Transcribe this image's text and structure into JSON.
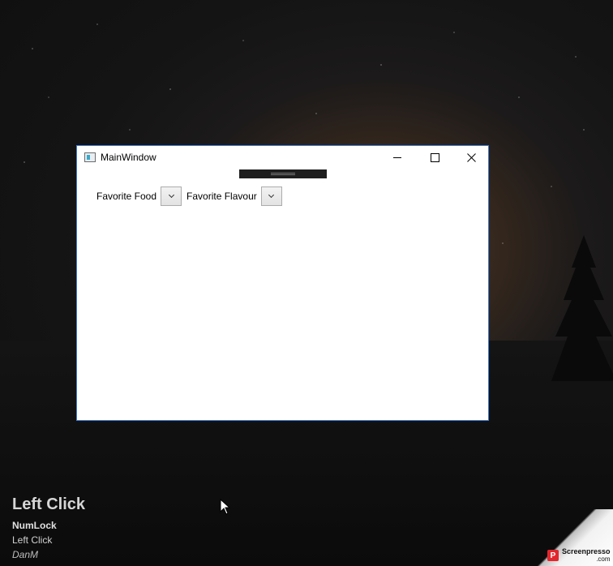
{
  "window": {
    "title": "MainWindow",
    "controls": {
      "minimize": "minimize",
      "maximize": "maximize",
      "close": "close"
    }
  },
  "form": {
    "food_label": "Favorite Food",
    "flavour_label": "Favorite Flavour"
  },
  "key_overlay": {
    "action": "Left Click",
    "key": "NumLock",
    "detail": "Left Click",
    "user": "DanM"
  },
  "watermark": {
    "brand": "Screenpresso",
    "domain": ".com",
    "icon_letter": "P"
  },
  "colors": {
    "window_border": "#3d7bd9",
    "watermark_red": "#e3262d"
  }
}
